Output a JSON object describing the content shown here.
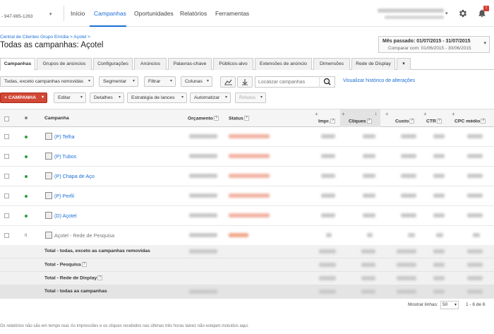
{
  "account": {
    "phone": "- 947-985-1263"
  },
  "nav": {
    "items": [
      "Início",
      "Campanhas",
      "Oportunidades",
      "Relatórios",
      "Ferramentas"
    ]
  },
  "header": {
    "breadcrumb": "Central de Clientes Grupo Emídia > Açotel >",
    "title": "Todas as campanhas: Açotel",
    "date_label": "Mês passado: 01/07/2015 - 31/07/2015",
    "compare_label": "Comparar com: 01/06/2015 - 30/06/2015"
  },
  "tabs": [
    "Campanhas",
    "Grupos de anúncios",
    "Configurações",
    "Anúncios",
    "Palavras-chave",
    "Públicos-alvo",
    "Extensões de anúncio",
    "Dimensões",
    "Rede de Display"
  ],
  "toolbar": {
    "filter_view": "Todas, exceto campanhas removidas",
    "segment": "Segmentar",
    "filter": "Filtrar",
    "columns": "Colunas",
    "search_placeholder": "Localizar campanhas",
    "history_link": "Visualizar histórico de alterações",
    "new_campaign": "+ CAMPANHA",
    "edit": "Editar",
    "details": "Detalhes",
    "bid_strategy": "Estratégia de lances",
    "automate": "Automatizar",
    "labels": "Rótulos"
  },
  "table": {
    "headers": {
      "campaign": "Campanha",
      "budget": "Orçamento",
      "status": "Status",
      "impr": "Impr.",
      "clicks": "Cliques",
      "cost": "Custo",
      "ctr": "CTR",
      "cpc": "CPC médio"
    },
    "rows": [
      {
        "name": "(P) Telha",
        "state": "active"
      },
      {
        "name": "(P) Tubos",
        "state": "active"
      },
      {
        "name": "(P) Chapa de Aço",
        "state": "active"
      },
      {
        "name": "(P) Perfil",
        "state": "active"
      },
      {
        "name": "(D) Açotel",
        "state": "active"
      },
      {
        "name": "Açotel - Rede de Pesquisa",
        "state": "paused"
      }
    ],
    "totals": [
      "Total - todas, exceto as campanhas removidas",
      "Total - Pesquisa",
      "Total - Rede de Display",
      "Total - todas as campanhas"
    ]
  },
  "pagination": {
    "label": "Mostrar linhas:",
    "value": "50",
    "range": "1 - 6 de 6"
  },
  "notice": "Os relatórios não são em tempo real. As impressões e os cliques recebidos nas últimas três horas talvez não estejam incluídos aqui.",
  "colors": {
    "accent": "#1a6ed8",
    "red_button": "#d14836",
    "active_dot": "#2e9e3e"
  }
}
